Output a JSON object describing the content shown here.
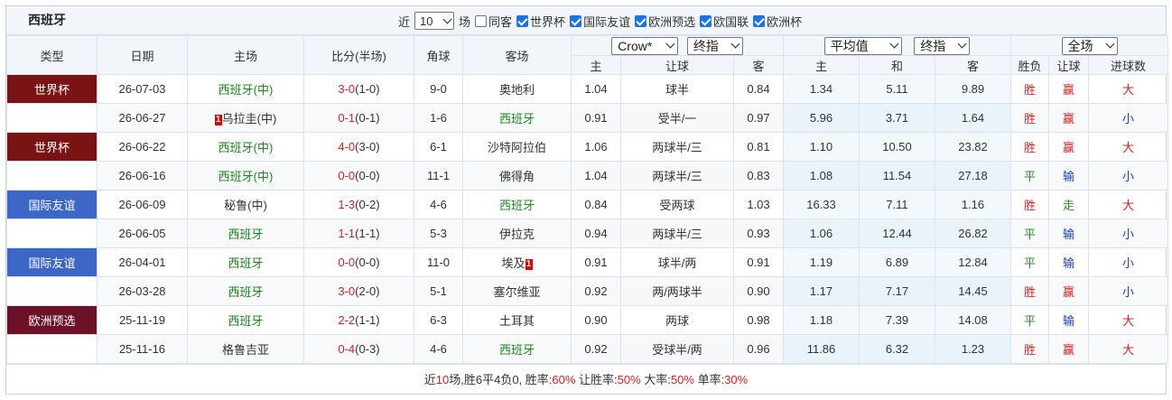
{
  "header": {
    "team": "西班牙",
    "recent_prefix": "近",
    "recent_count": "10",
    "recent_suffix": "场",
    "same_home_label": "同客",
    "filters": [
      {
        "label": "世界杯",
        "checked": true
      },
      {
        "label": "国际友谊",
        "checked": true
      },
      {
        "label": "欧洲预选",
        "checked": true
      },
      {
        "label": "欧国联",
        "checked": true
      },
      {
        "label": "欧洲杯",
        "checked": true
      }
    ]
  },
  "columns": {
    "type": "类型",
    "date": "日期",
    "home": "主场",
    "score": "比分(半场)",
    "corner": "角球",
    "away": "客场",
    "company_select": "Crow*",
    "handicap_mode_select": "终指",
    "avg_select": "平均值",
    "avg_mode_select": "终指",
    "period_select": "全场",
    "handicap_sub": [
      "主",
      "让球",
      "客"
    ],
    "odds_sub": [
      "主",
      "和",
      "客"
    ],
    "result_sub": [
      "胜负",
      "让球",
      "进球数"
    ]
  },
  "rows": [
    {
      "type": "世界杯",
      "cls": "wc",
      "date": "26-07-03",
      "home": "西班牙(中)",
      "home_green": true,
      "home_red_card": "",
      "score": "3-0",
      "half": "(1-0)",
      "corner": "9-0",
      "away": "奥地利",
      "away_green": false,
      "away_red_card": "",
      "h_home": "1.04",
      "h_line": "球半",
      "h_away": "0.84",
      "o_home": "1.34",
      "o_draw": "5.11",
      "o_away": "9.89",
      "wl": "胜",
      "wl_c": "red",
      "hc": "赢",
      "hc_c": "red",
      "ou": "大",
      "ou_c": "red"
    },
    {
      "type": "世界杯",
      "cls": "wc",
      "date": "26-06-27",
      "home": "乌拉圭(中)",
      "home_green": false,
      "home_red_card": "1",
      "score": "0-1",
      "half": "(0-1)",
      "corner": "1-6",
      "away": "西班牙",
      "away_green": true,
      "away_red_card": "",
      "h_home": "0.91",
      "h_line": "受半/一",
      "h_away": "0.97",
      "o_home": "5.96",
      "o_draw": "3.71",
      "o_away": "1.64",
      "wl": "胜",
      "wl_c": "red",
      "hc": "赢",
      "hc_c": "red",
      "ou": "小",
      "ou_c": "blue"
    },
    {
      "type": "世界杯",
      "cls": "wc",
      "date": "26-06-22",
      "home": "西班牙(中)",
      "home_green": true,
      "home_red_card": "",
      "score": "4-0",
      "half": "(3-0)",
      "corner": "6-1",
      "away": "沙特阿拉伯",
      "away_green": false,
      "away_red_card": "",
      "h_home": "1.06",
      "h_line": "两球半/三",
      "h_away": "0.81",
      "o_home": "1.10",
      "o_draw": "10.50",
      "o_away": "23.82",
      "wl": "胜",
      "wl_c": "red",
      "hc": "赢",
      "hc_c": "red",
      "ou": "大",
      "ou_c": "red"
    },
    {
      "type": "世界杯",
      "cls": "wc",
      "date": "26-06-16",
      "home": "西班牙(中)",
      "home_green": true,
      "home_red_card": "",
      "score": "0-0",
      "half": "(0-0)",
      "corner": "11-1",
      "away": "佛得角",
      "away_green": false,
      "away_red_card": "",
      "h_home": "1.04",
      "h_line": "两球半/三",
      "h_away": "0.83",
      "o_home": "1.08",
      "o_draw": "11.54",
      "o_away": "27.18",
      "wl": "平",
      "wl_c": "olive",
      "hc": "输",
      "hc_c": "blue",
      "ou": "小",
      "ou_c": "blue"
    },
    {
      "type": "国际友谊",
      "cls": "fr",
      "date": "26-06-09",
      "home": "秘鲁(中)",
      "home_green": false,
      "home_red_card": "",
      "score": "1-3",
      "half": "(0-2)",
      "corner": "4-6",
      "away": "西班牙",
      "away_green": true,
      "away_red_card": "",
      "h_home": "0.84",
      "h_line": "受两球",
      "h_away": "1.03",
      "o_home": "16.33",
      "o_draw": "7.11",
      "o_away": "1.16",
      "wl": "胜",
      "wl_c": "red",
      "hc": "走",
      "hc_c": "olive",
      "ou": "大",
      "ou_c": "red"
    },
    {
      "type": "国际友谊",
      "cls": "fr",
      "date": "26-06-05",
      "home": "西班牙",
      "home_green": true,
      "home_red_card": "",
      "score": "1-1",
      "half": "(1-1)",
      "corner": "5-3",
      "away": "伊拉克",
      "away_green": false,
      "away_red_card": "",
      "h_home": "0.94",
      "h_line": "两球半/三",
      "h_away": "0.93",
      "o_home": "1.06",
      "o_draw": "12.44",
      "o_away": "26.82",
      "wl": "平",
      "wl_c": "olive",
      "hc": "输",
      "hc_c": "blue",
      "ou": "小",
      "ou_c": "blue"
    },
    {
      "type": "国际友谊",
      "cls": "fr",
      "date": "26-04-01",
      "home": "西班牙",
      "home_green": true,
      "home_red_card": "",
      "score": "0-0",
      "half": "(0-0)",
      "corner": "11-0",
      "away": "埃及",
      "away_green": false,
      "away_red_card": "1",
      "h_home": "0.91",
      "h_line": "球半/两",
      "h_away": "0.91",
      "o_home": "1.19",
      "o_draw": "6.89",
      "o_away": "12.84",
      "wl": "平",
      "wl_c": "olive",
      "hc": "输",
      "hc_c": "blue",
      "ou": "小",
      "ou_c": "blue"
    },
    {
      "type": "国际友谊",
      "cls": "fr",
      "date": "26-03-28",
      "home": "西班牙",
      "home_green": true,
      "home_red_card": "",
      "score": "3-0",
      "half": "(2-0)",
      "corner": "5-1",
      "away": "塞尔维亚",
      "away_green": false,
      "away_red_card": "",
      "h_home": "0.92",
      "h_line": "两/两球半",
      "h_away": "0.90",
      "o_home": "1.17",
      "o_draw": "7.17",
      "o_away": "14.45",
      "wl": "胜",
      "wl_c": "red",
      "hc": "赢",
      "hc_c": "red",
      "ou": "小",
      "ou_c": "blue"
    },
    {
      "type": "欧洲预选",
      "cls": "eq",
      "date": "25-11-19",
      "home": "西班牙",
      "home_green": true,
      "home_red_card": "",
      "score": "2-2",
      "half": "(1-1)",
      "corner": "6-3",
      "away": "土耳其",
      "away_green": false,
      "away_red_card": "",
      "h_home": "0.90",
      "h_line": "两球",
      "h_away": "0.98",
      "o_home": "1.18",
      "o_draw": "7.39",
      "o_away": "14.08",
      "wl": "平",
      "wl_c": "olive",
      "hc": "输",
      "hc_c": "blue",
      "ou": "大",
      "ou_c": "red"
    },
    {
      "type": "欧洲预选",
      "cls": "eq",
      "date": "25-11-16",
      "home": "格鲁吉亚",
      "home_green": false,
      "home_red_card": "",
      "score": "0-4",
      "half": "(0-3)",
      "corner": "4-6",
      "away": "西班牙",
      "away_green": true,
      "away_red_card": "",
      "h_home": "0.92",
      "h_line": "受球半/两",
      "h_away": "0.96",
      "o_home": "11.86",
      "o_draw": "6.32",
      "o_away": "1.23",
      "wl": "胜",
      "wl_c": "red",
      "hc": "赢",
      "hc_c": "red",
      "ou": "大",
      "ou_c": "red"
    }
  ],
  "summary": {
    "p1": "近",
    "n_matches": "10",
    "p2": "场,胜6平4负0, 胜率:",
    "win_rate": "60%",
    "p3": " 让胜率:",
    "hc_rate": "50%",
    "p4": " 大率:",
    "over_rate": "50%",
    "p5": " 单率:",
    "odd_rate": "30%"
  }
}
